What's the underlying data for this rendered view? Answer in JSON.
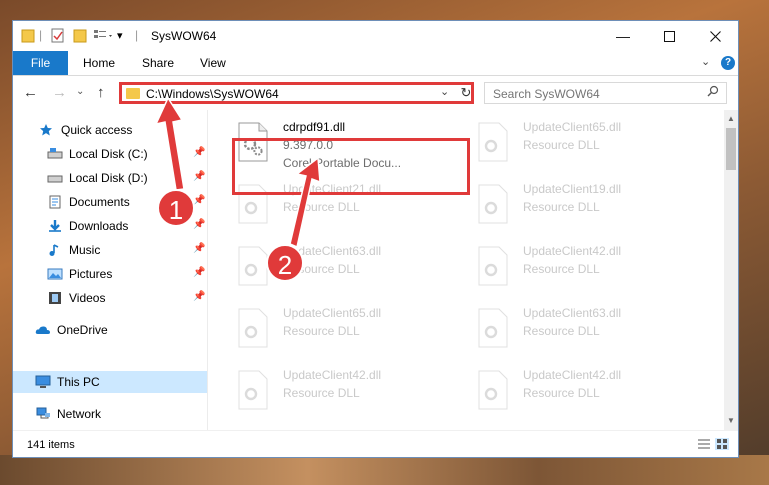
{
  "window": {
    "title": "SysWOW64"
  },
  "ribbon": {
    "file_tab": "File",
    "tabs": [
      "Home",
      "Share",
      "View"
    ]
  },
  "address": {
    "path": "C:\\Windows\\SysWOW64"
  },
  "search": {
    "placeholder": "Search SysWOW64"
  },
  "sidebar": {
    "quick_access": "Quick access",
    "items": [
      {
        "label": "Local Disk (C:)",
        "icon": "local-disk-icon"
      },
      {
        "label": "Local Disk (D:)",
        "icon": "local-disk-icon"
      },
      {
        "label": "Documents",
        "icon": "documents-icon"
      },
      {
        "label": "Downloads",
        "icon": "downloads-icon"
      },
      {
        "label": "Music",
        "icon": "music-icon"
      },
      {
        "label": "Pictures",
        "icon": "pictures-icon"
      },
      {
        "label": "Videos",
        "icon": "videos-icon"
      }
    ],
    "onedrive": "OneDrive",
    "this_pc": "This PC",
    "network": "Network"
  },
  "files": {
    "highlighted": {
      "name": "cdrpdf91.dll",
      "version": "9.397.0.0",
      "description": "Corel Portable Docu..."
    },
    "background": [
      {
        "name": "UpdateClient65.dll",
        "type": "Resource DLL"
      },
      {
        "name": "UpdateClient21.dll",
        "type": "Resource DLL"
      },
      {
        "name": "UpdateClient19.dll",
        "type": "Resource DLL"
      },
      {
        "name": "UpdateClient63.dll",
        "type": "Resource DLL"
      },
      {
        "name": "UpdateClient42.dll",
        "type": "Resource DLL"
      },
      {
        "name": "UpdateClient65.dll",
        "type": "Resource DLL"
      },
      {
        "name": "UpdateClient63.dll",
        "type": "Resource DLL"
      },
      {
        "name": "UpdateClient42.dll",
        "type": "Resource DLL"
      },
      {
        "name": "UpdateClient42.dll",
        "type": "Resource DLL"
      }
    ]
  },
  "status": {
    "item_count": "141 items"
  },
  "annotations": {
    "step1": "1",
    "step2": "2"
  },
  "colors": {
    "accent": "#1979ca",
    "annotation": "#e03a3a",
    "selected": "#cce8ff"
  }
}
